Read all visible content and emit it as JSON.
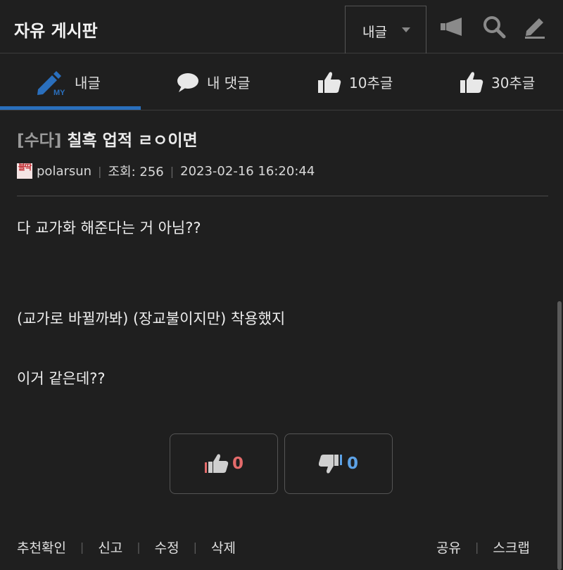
{
  "header": {
    "title": "자유 게시판",
    "select_label": "내글",
    "icons": [
      "megaphone-icon",
      "search-icon",
      "pencil-icon"
    ]
  },
  "tabs": [
    {
      "label": "내글",
      "icon": "my-pencil-icon",
      "active": true
    },
    {
      "label": "내 댓글",
      "icon": "speech-bubble-icon"
    },
    {
      "label": "10추글",
      "icon": "thumbs-up-icon"
    },
    {
      "label": "30추글",
      "icon": "thumbs-up-icon"
    }
  ],
  "post": {
    "category": "[수다]",
    "title": "칠흑 업적 ㄹㅇ이면",
    "author_avatar": "블딱",
    "author": "polarsun",
    "views": "조회: 256",
    "date": "2023-02-16 16:20:44",
    "body": [
      "다 교가화 해준다는 거 아님??",
      "(교가로 바뀔까봐) (장교불이지만) 착용했지",
      "이거 같은데??"
    ]
  },
  "votes": {
    "up": "0",
    "down": "0",
    "up_color": "#e46b6b",
    "down_color": "#5da2e6"
  },
  "actions": {
    "left": [
      "추천확인",
      "신고",
      "수정",
      "삭제"
    ],
    "right": [
      "공유",
      "스크랩"
    ]
  },
  "colors": {
    "background": "#1f1f1f",
    "accent": "#2a6fbd"
  }
}
